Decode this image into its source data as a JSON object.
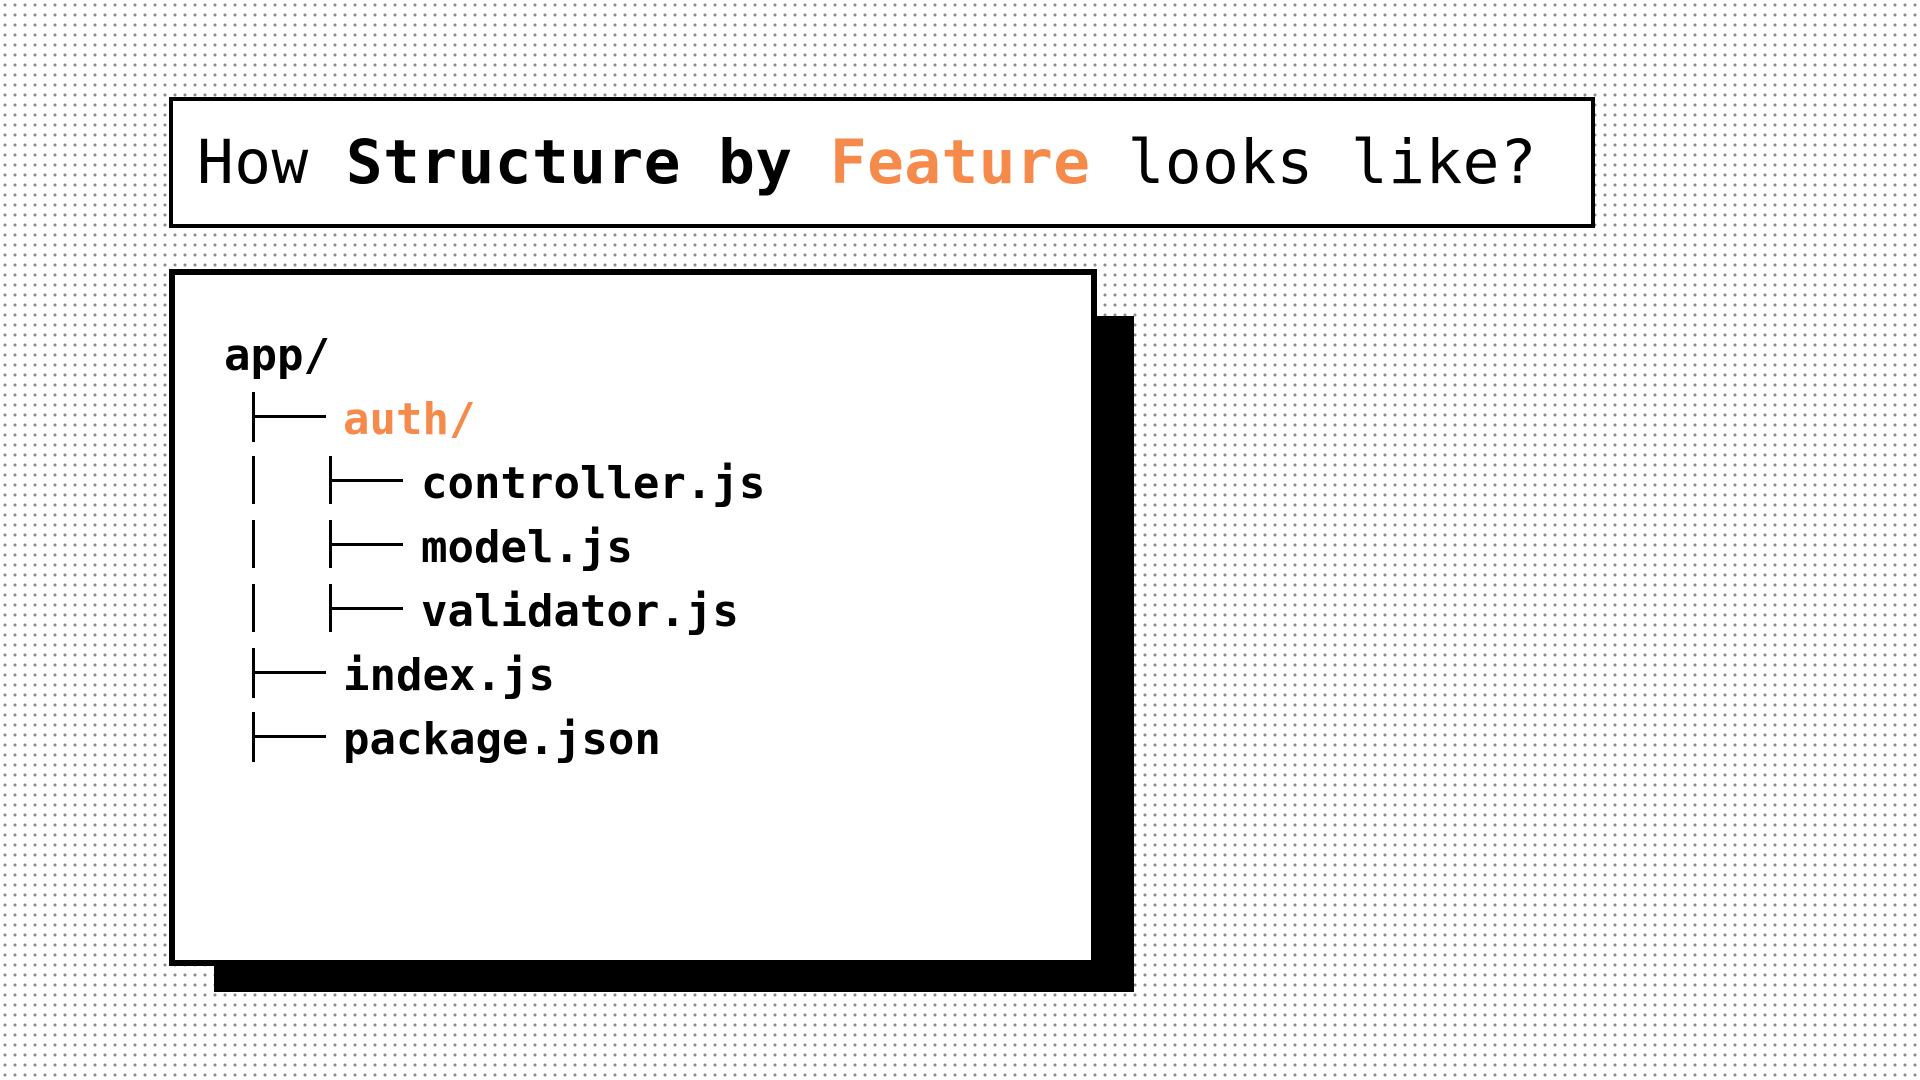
{
  "title": {
    "part1": "How ",
    "part2": "Structure by",
    "part3": " ",
    "part4": "Feature",
    "part5": " looks like?"
  },
  "colors": {
    "accent": "#f58a4b",
    "text": "#000000",
    "background": "#ffffff"
  },
  "tree": {
    "root": "app/",
    "items": [
      {
        "label": "auth/",
        "depth": 1
      },
      {
        "label": "controller.js",
        "depth": 2
      },
      {
        "label": "model.js",
        "depth": 2
      },
      {
        "label": "validator.js",
        "depth": 2
      },
      {
        "label": "index.js",
        "depth": 1
      },
      {
        "label": "package.json",
        "depth": 1
      }
    ]
  }
}
